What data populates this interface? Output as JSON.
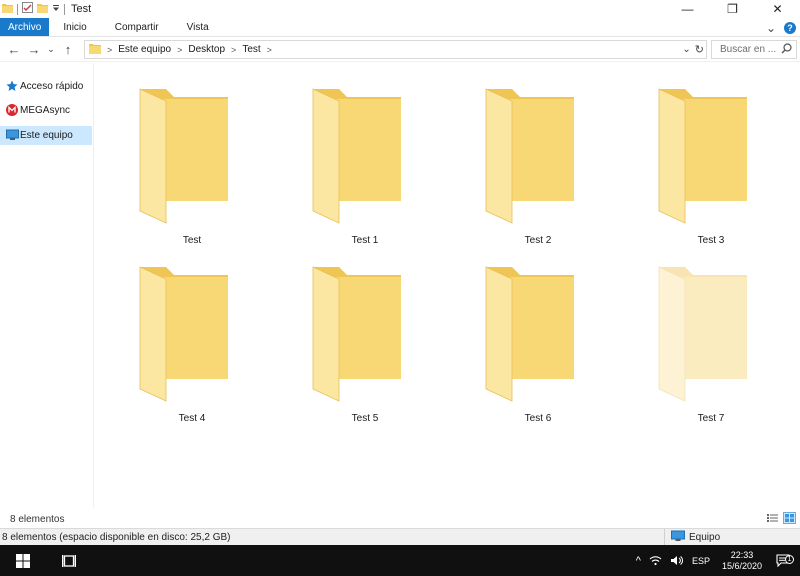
{
  "window": {
    "title": "Test",
    "controls": {
      "minimize": "—",
      "maximize": "❐",
      "close": "✕"
    }
  },
  "ribbon": {
    "tabs": [
      {
        "label": "Archivo",
        "active": true
      },
      {
        "label": "Inicio"
      },
      {
        "label": "Compartir"
      },
      {
        "label": "Vista"
      }
    ],
    "help_label": "?",
    "expand_glyph": "⌄"
  },
  "navigation": {
    "back": "←",
    "forward": "→",
    "recent": "⌄",
    "up": "↑",
    "breadcrumb": [
      "Este equipo",
      "Desktop",
      "Test"
    ],
    "breadcrumb_separator": ">",
    "dropdown_glyph": "⌄",
    "refresh_glyph": "↻",
    "search_placeholder": "Buscar en ..."
  },
  "sidebar": {
    "items": [
      {
        "label": "Acceso rápido",
        "icon": "star-pin-icon",
        "selected": false
      },
      {
        "label": "MEGAsync",
        "icon": "mega-icon",
        "selected": false
      },
      {
        "label": "Este equipo",
        "icon": "computer-icon",
        "selected": true
      }
    ]
  },
  "folders": [
    {
      "name": "Test",
      "faded": false
    },
    {
      "name": "Test 1",
      "faded": false
    },
    {
      "name": "Test 2",
      "faded": false
    },
    {
      "name": "Test 3",
      "faded": false
    },
    {
      "name": "Test 4",
      "faded": false
    },
    {
      "name": "Test 5",
      "faded": false
    },
    {
      "name": "Test 6",
      "faded": false
    },
    {
      "name": "Test 7",
      "faded": true
    }
  ],
  "status": {
    "item_count": "8 elementos",
    "disk_info": "8 elementos (espacio disponible en disco: 25,2 GB)",
    "location": "Equipo"
  },
  "taskbar": {
    "language": "ESP",
    "time": "22:33",
    "date": "15/6/2020",
    "tray_up": "^",
    "notification_count": "1"
  },
  "colors": {
    "accent": "#1979ca",
    "selection": "#cce8ff",
    "folder_front": "#f8d775",
    "folder_back": "#efc556",
    "taskbar": "#101010"
  }
}
